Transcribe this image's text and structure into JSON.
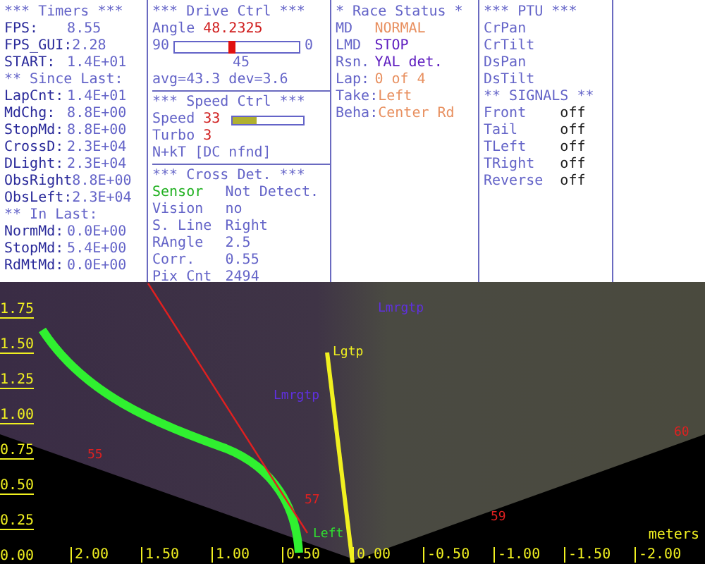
{
  "panels": [
    {
      "sections": [
        {
          "rows": [
            {
              "kind": "header",
              "text": "*** Timers ***"
            },
            {
              "kind": "pair",
              "label": "FPS:",
              "value": "8.55"
            },
            {
              "kind": "pair",
              "label": "FPS_GUI:",
              "value": "2.28"
            },
            {
              "kind": "pair",
              "label": "START:",
              "value": "1.4E+01"
            },
            {
              "kind": "header",
              "text": "** Since Last:"
            },
            {
              "kind": "pair",
              "label": "LapCnt:",
              "value": "1.4E+01"
            },
            {
              "kind": "pair",
              "label": "MdChg:",
              "value": "8.8E+00"
            },
            {
              "kind": "pair",
              "label": "StopMd:",
              "value": "8.8E+00"
            },
            {
              "kind": "pair",
              "label": "CrossD:",
              "value": "2.3E+04"
            },
            {
              "kind": "pair",
              "label": "DLight:",
              "value": "2.3E+04"
            },
            {
              "kind": "pair",
              "label": "ObsRight",
              "value": "8.8E+00"
            },
            {
              "kind": "pair",
              "label": "ObsLeft:",
              "value": "2.3E+04"
            },
            {
              "kind": "header",
              "text": "** In Last:"
            },
            {
              "kind": "pair",
              "label": "NormMd:",
              "value": "0.0E+00"
            },
            {
              "kind": "pair",
              "label": "StopMd:",
              "value": "5.4E+00"
            },
            {
              "kind": "pair",
              "label": "RdMtMd:",
              "value": "0.0E+00"
            }
          ]
        }
      ]
    },
    {
      "sections": [
        {
          "rows": [
            {
              "kind": "header",
              "text": "*** Drive Ctrl ***"
            },
            {
              "kind": "pair",
              "label": "Angle",
              "value": "48.2325",
              "color": "#d02020"
            },
            {
              "kind": "slider",
              "min_label": "90",
              "max_label": "0",
              "mid_label": "45",
              "level": 0.45
            },
            {
              "kind": "text",
              "text": "avg=43.3 dev=3.6"
            }
          ]
        },
        {
          "rows": [
            {
              "kind": "header",
              "text": "*** Speed Ctrl ***"
            },
            {
              "kind": "bar",
              "label": "Speed",
              "value": "33",
              "color": "#d02020",
              "level": 0.33
            },
            {
              "kind": "pair",
              "label": "Turbo",
              "value": "3",
              "color": "#d02020"
            },
            {
              "kind": "text",
              "text": "N+kT [DC nfnd]"
            }
          ]
        },
        {
          "rows": [
            {
              "kind": "header",
              "text": "*** Cross Det. ***"
            },
            {
              "kind": "status",
              "label": "Sensor",
              "value": "Not Detect.",
              "color": "#20b020"
            },
            {
              "kind": "pair",
              "label": "Vision",
              "value": "no"
            },
            {
              "kind": "pair",
              "label": "S. Line",
              "value": "Right"
            },
            {
              "kind": "pair",
              "label": "RAngle",
              "value": "2.5"
            },
            {
              "kind": "pair",
              "label": "Corr.",
              "value": "0.55"
            },
            {
              "kind": "pair",
              "label": "Pix Cnt",
              "value": "2494"
            }
          ]
        }
      ]
    },
    {
      "sections": [
        {
          "rows": [
            {
              "kind": "header",
              "text": "* Race Status *"
            },
            {
              "kind": "pair",
              "label": "MD",
              "value": "NORMAL",
              "color": "#e89060"
            },
            {
              "kind": "pair",
              "label": "LMD",
              "value": "STOP",
              "color": "#6020c0"
            },
            {
              "kind": "pair",
              "label": "Rsn.",
              "value": "YAL det.",
              "color": "#6020c0"
            },
            {
              "kind": "pair",
              "label": "Lap:",
              "value": "0 of 4",
              "color": "#e89060"
            },
            {
              "kind": "pair",
              "label": "Take:",
              "value": "Left",
              "color": "#e89060"
            },
            {
              "kind": "pair",
              "label": "Beha:",
              "value": "Center Rd",
              "color": "#e89060"
            }
          ]
        }
      ]
    },
    {
      "sections": [
        {
          "rows": [
            {
              "kind": "header",
              "text": "*** PTU ***"
            },
            {
              "kind": "pair",
              "label": "CrPan"
            },
            {
              "kind": "pair",
              "label": "CrTilt"
            },
            {
              "kind": "pair",
              "label": "DsPan"
            },
            {
              "kind": "pair",
              "label": "DsTilt"
            },
            {
              "kind": "header",
              "text": "** SIGNALS **"
            },
            {
              "kind": "pair",
              "label": "Front",
              "value": "off",
              "color": "#202020"
            },
            {
              "kind": "pair",
              "label": "Tail",
              "value": "off",
              "color": "#202020"
            },
            {
              "kind": "pair",
              "label": "TLeft",
              "value": "off",
              "color": "#202020"
            },
            {
              "kind": "pair",
              "label": "TRight",
              "value": "off",
              "color": "#202020"
            },
            {
              "kind": "pair",
              "label": "Reverse",
              "value": "off",
              "color": "#202020"
            }
          ]
        }
      ]
    }
  ],
  "camera": {
    "y_axis": [
      "1.75",
      "1.50",
      "1.25",
      "1.00",
      "0.75",
      "0.50",
      "0.25",
      "0.00"
    ],
    "x_axis": [
      "2.00",
      "1.50",
      "1.00",
      "0.50",
      "0.00",
      "-0.50",
      "-1.00",
      "-1.50",
      "-2.00"
    ],
    "unit": "meters",
    "markers": [
      {
        "text": "Lgtp",
        "color": "#f0f020"
      },
      {
        "text": "Lmrgtp",
        "color": "#6030e0"
      },
      {
        "text": "Lmrgtp",
        "color": "#6030e0"
      },
      {
        "text": "Left",
        "color": "#30e030"
      },
      {
        "text": "55",
        "color": "#e02020"
      },
      {
        "text": "57",
        "color": "#e02020"
      },
      {
        "text": "59",
        "color": "#e02020"
      },
      {
        "text": "60",
        "color": "#e02020"
      }
    ]
  }
}
